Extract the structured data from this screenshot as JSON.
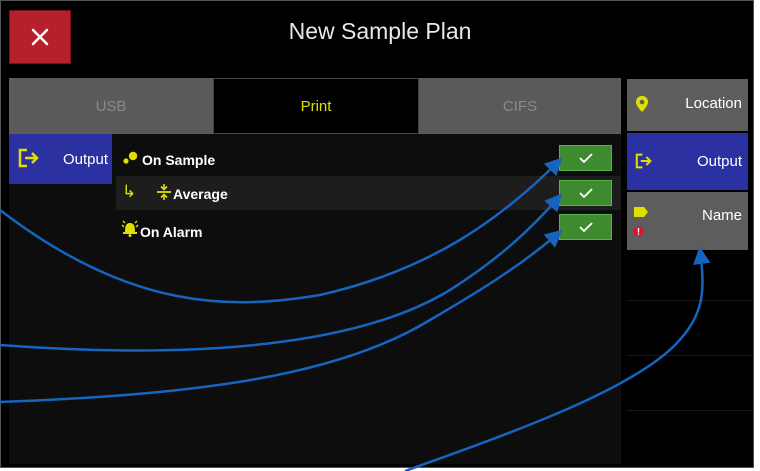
{
  "header": {
    "title": "New Sample Plan",
    "close_icon": "close-icon"
  },
  "tabs": [
    {
      "label": "USB",
      "active": false
    },
    {
      "label": "Print",
      "active": true
    },
    {
      "label": "CIFS",
      "active": false
    }
  ],
  "left_panel": {
    "output_label": "Output"
  },
  "rows": [
    {
      "label": "On Sample",
      "checked": true
    },
    {
      "label": "Average",
      "checked": true
    },
    {
      "label": "On Alarm",
      "checked": true
    }
  ],
  "sidebar": [
    {
      "label": "Location",
      "icon": "location-pin-icon"
    },
    {
      "label": "Output",
      "icon": "output-icon",
      "active": true
    },
    {
      "label": "Name",
      "icon": "tag-icon"
    }
  ],
  "colors": {
    "accent_yellow": "#e0e000",
    "active_blue": "#2b31a0",
    "check_green": "#3e8a2e",
    "close_red": "#b5202a",
    "callout_blue": "#1565c0"
  }
}
